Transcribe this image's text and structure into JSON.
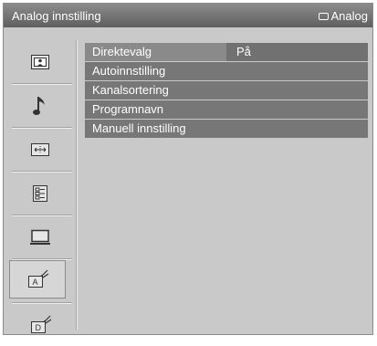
{
  "titlebar": {
    "title": "Analog innstilling",
    "source_label": "Analog",
    "source_icon": "tv-icon"
  },
  "sidebar": {
    "items": [
      {
        "icon": "picture-icon"
      },
      {
        "icon": "music-note-icon"
      },
      {
        "icon": "screen-control-icon"
      },
      {
        "icon": "settings-list-icon"
      },
      {
        "icon": "pc-monitor-icon"
      },
      {
        "icon": "analog-tuning-icon",
        "selected": true
      },
      {
        "icon": "digital-tuning-icon"
      }
    ]
  },
  "menu": {
    "items": [
      {
        "label": "Direktevalg",
        "value": "På"
      },
      {
        "label": "Autoinnstilling",
        "value": ""
      },
      {
        "label": "Kanalsortering",
        "value": ""
      },
      {
        "label": "Programnavn",
        "value": ""
      },
      {
        "label": "Manuell innstilling",
        "value": ""
      }
    ]
  }
}
